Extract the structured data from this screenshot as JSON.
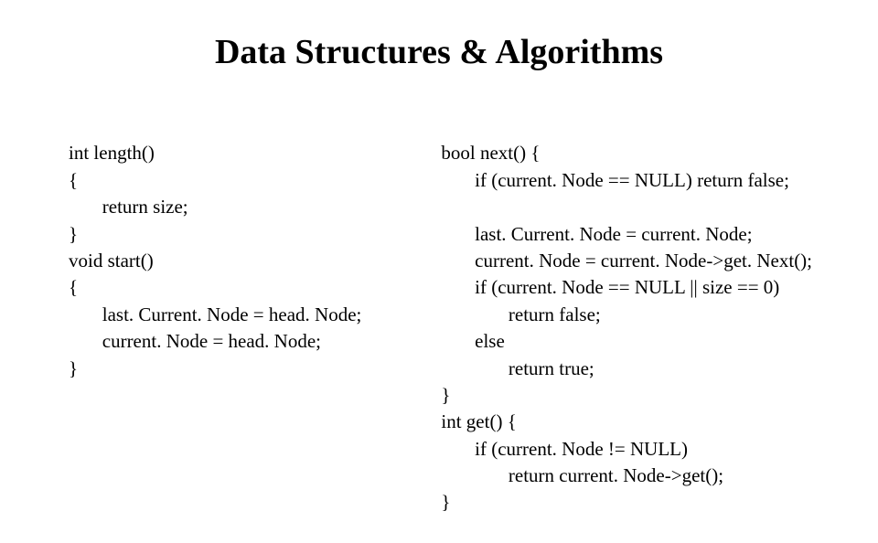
{
  "title": "Data Structures & Algorithms",
  "left": {
    "l1": "int length()",
    "l2": "{",
    "l3": "       return size;",
    "l4": "}",
    "l5": "void start()",
    "l6": "{",
    "l7": "       last. Current. Node = head. Node;",
    "l8": "       current. Node = head. Node;",
    "l9": "}"
  },
  "right": {
    "l1": "bool next() {",
    "l2": "       if (current. Node == NULL) return false;",
    "l3": "",
    "l4": "       last. Current. Node = current. Node;",
    "l5": "       current. Node = current. Node->get. Next();",
    "l6": "       if (current. Node == NULL || size == 0)",
    "l7": "              return false;",
    "l8": "       else",
    "l9": "              return true;",
    "l10": "}",
    "l11": "int get() {",
    "l12": "       if (current. Node != NULL)",
    "l13": "              return current. Node->get();",
    "l14": "}"
  }
}
